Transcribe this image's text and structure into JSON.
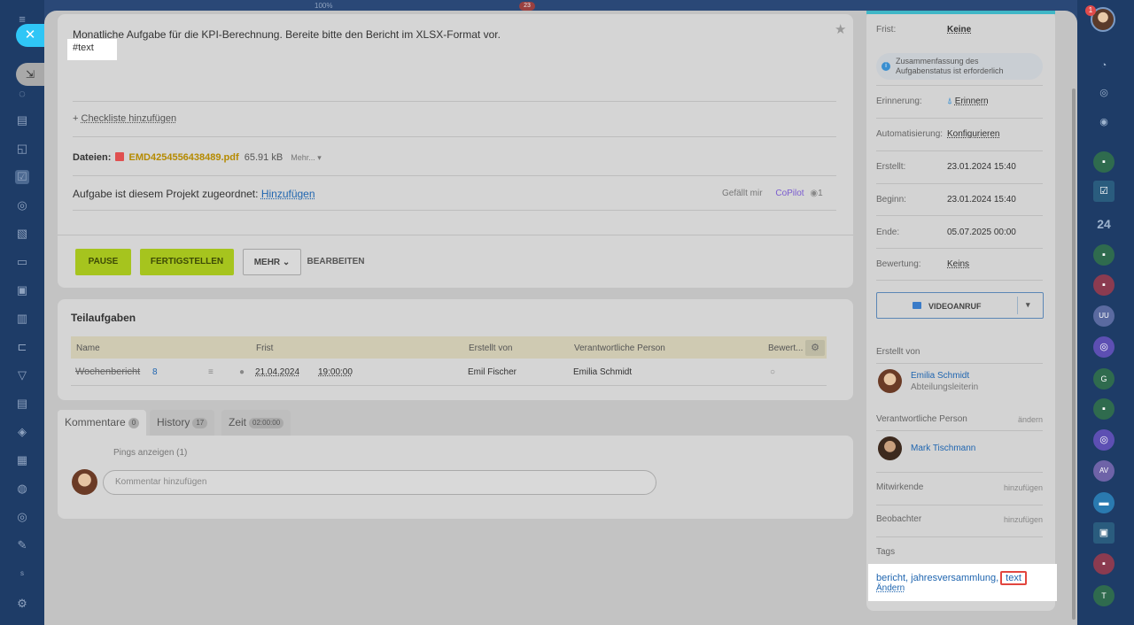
{
  "top": {
    "zoom": "100%",
    "notification_count": "23"
  },
  "left_rail": {
    "close_glyph": "✕",
    "minimize_glyph": "⇲"
  },
  "right_rail": {
    "badge": "1",
    "counter_24": "24",
    "letter_g": "G",
    "initials_uu": "UU",
    "initials_av": "AV",
    "letter_t": "T"
  },
  "task": {
    "description": "Monatliche Aufgabe für die KPI-Berechnung. Bereite bitte den Bericht im XLSX-Format vor.",
    "hash_tag": "#text",
    "checklist_prefix": "+",
    "checklist_link": "Checkliste hinzufügen",
    "files_label": "Dateien:",
    "file_name": "EMD4254556438489.pdf",
    "file_size": "65.91 kB",
    "file_more": "Mehr... ▾",
    "project_label": "Aufgabe ist diesem Projekt zugeordnet:",
    "project_link": "Hinzufügen",
    "likes_label": "Gefällt mir",
    "liked_by": "CoPilot",
    "views": "1"
  },
  "actions": {
    "pause": "PAUSE",
    "finish": "FERTIGSTELLEN",
    "more": "MEHR",
    "edit": "BEARBEITEN"
  },
  "subtasks": {
    "title": "Teilaufgaben",
    "columns": [
      "Name",
      "Frist",
      "Erstellt von",
      "Verantwortliche Person",
      "Bewert..."
    ],
    "row": {
      "name": "Wochenbericht",
      "count": "8",
      "date": "21.04.2024",
      "time": "19:00:00",
      "created_by": "Emil Fischer",
      "responsible": "Emilia Schmidt"
    }
  },
  "tabs": [
    {
      "label": "Kommentare",
      "count": "0"
    },
    {
      "label": "History",
      "count": "17"
    },
    {
      "label": "Zeit",
      "count": "02:00:00"
    }
  ],
  "comments": {
    "pings": "Pings anzeigen (1)",
    "placeholder": "Kommentar hinzufügen"
  },
  "sidebar": {
    "deadline_label": "Frist:",
    "deadline_value": "Keine",
    "notice": "Zusammenfassung des Aufgabenstatus ist erforderlich",
    "reminder_label": "Erinnerung:",
    "reminder_value": "Erinnern",
    "automation_label": "Automatisierung:",
    "automation_value": "Konfigurieren",
    "created_label": "Erstellt:",
    "created_value": "23.01.2024 15:40",
    "start_label": "Beginn:",
    "start_value": "23.01.2024 15:40",
    "end_label": "Ende:",
    "end_value": "05.07.2025 00:00",
    "rating_label": "Bewertung:",
    "rating_value": "Keins",
    "video_call": "VIDEOANRUF",
    "created_by_label": "Erstellt von",
    "creator_name": "Emilia Schmidt",
    "creator_role": "Abteilungsleiterin",
    "responsible_label": "Verantwortliche Person",
    "responsible_action": "ändern",
    "responsible_name": "Mark Tischmann",
    "participants_label": "Mitwirkende",
    "participants_action": "hinzufügen",
    "observers_label": "Beobachter",
    "observers_action": "hinzufügen",
    "tags_label": "Tags",
    "tags_list": "bericht, jahresversammlung,",
    "tag_highlight": "text",
    "tags_change": "Ändern"
  },
  "colors": {
    "accent_green": "#a6c41e",
    "link_blue": "#2066b0",
    "highlight_red": "#e2463f",
    "rail_blue": "#1e3c67"
  }
}
